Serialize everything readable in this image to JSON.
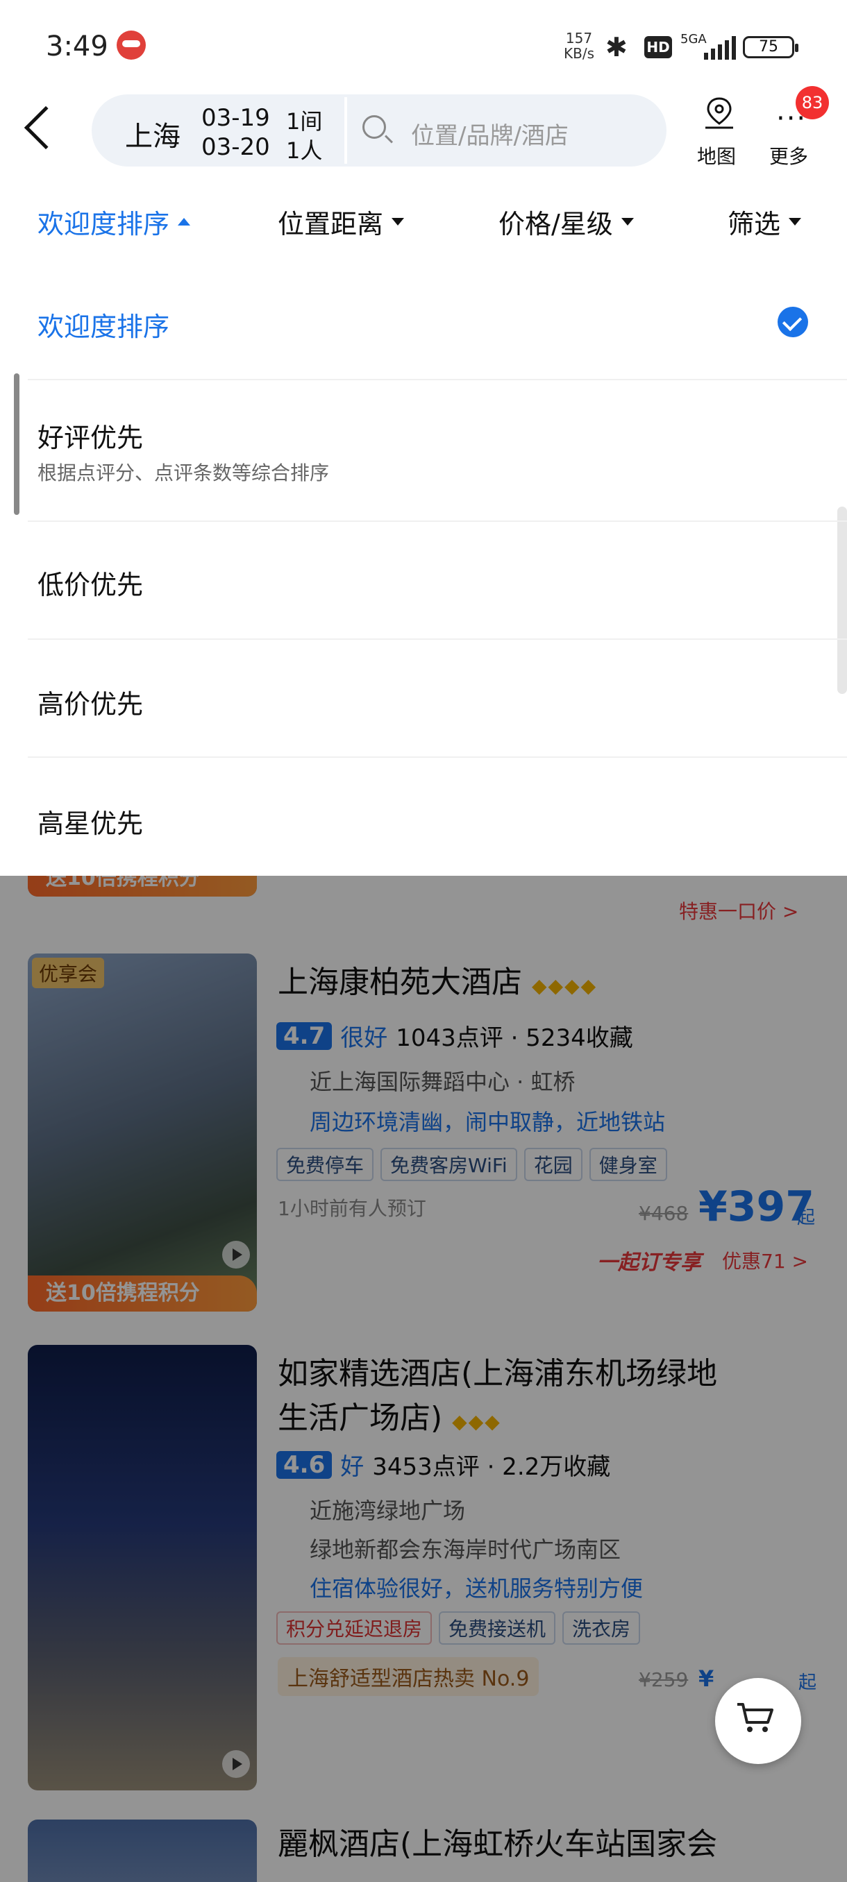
{
  "status_bar": {
    "time": "3:49",
    "speed_top": "157",
    "speed_bottom": "KB/s",
    "hd": "HD",
    "network": "5GA",
    "battery": "75"
  },
  "header": {
    "city": "上海",
    "check_in": "03-19",
    "check_out": "03-20",
    "rooms": "1间",
    "guests": "1人",
    "search_placeholder": "位置/品牌/酒店",
    "map_label": "地图",
    "more_label": "更多",
    "more_badge": "83"
  },
  "sort_tabs": [
    {
      "label": "欢迎度排序",
      "active": true
    },
    {
      "label": "位置距离"
    },
    {
      "label": "价格/星级"
    },
    {
      "label": "筛选"
    }
  ],
  "sort_options": [
    {
      "label": "欢迎度排序",
      "selected": true
    },
    {
      "label": "好评优先",
      "description": "根据点评分、点评条数等综合排序"
    },
    {
      "label": "低价优先"
    },
    {
      "label": "高价优先"
    },
    {
      "label": "高星优先"
    }
  ],
  "hotels": [
    {
      "promo": "送10倍携程积分",
      "deal_link": "特惠一口价 >"
    },
    {
      "thumb_badge": "优享会",
      "promo": "送10倍携程积分",
      "name": "上海康柏苑大酒店",
      "stars": "◆◆◆◆",
      "score": "4.7",
      "score_word": "很好",
      "review_stats": "1043点评 · 5234收藏",
      "location": "近上海国际舞蹈中心 · 虹桥",
      "highlight": "周边环境清幽，闹中取静，近地铁站",
      "tags": [
        "免费停车",
        "免费客房WiFi",
        "花园",
        "健身室"
      ],
      "booked_note": "1小时前有人预订",
      "old_price": "¥468",
      "price": "¥397",
      "price_suffix": "起",
      "deal_red": "一起订专享",
      "deal_link": "优惠71 >"
    },
    {
      "name_line1": "如家精选酒店(上海浦东机场绿地",
      "name_line2": "生活广场店)",
      "stars": "◆◆◆",
      "score": "4.6",
      "score_word": "好",
      "review_stats": "3453点评 · 2.2万收藏",
      "location": "近施湾绿地广场",
      "location2": "绿地新都会东海岸时代广场南区",
      "highlight": "住宿体验很好，送机服务特别方便",
      "tags": [
        "积分兑延迟退房",
        "免费接送机",
        "洗衣房"
      ],
      "rank": "上海舒适型酒店热卖 No.9",
      "old_price": "¥259",
      "price": "¥",
      "price_suffix": "起"
    },
    {
      "name": "麗枫酒店(上海虹桥火车站国家会"
    }
  ],
  "colors": {
    "accent": "#1a73e8",
    "badge": "#f23030",
    "promo": "#ff6a2a",
    "star": "#f5b400"
  }
}
